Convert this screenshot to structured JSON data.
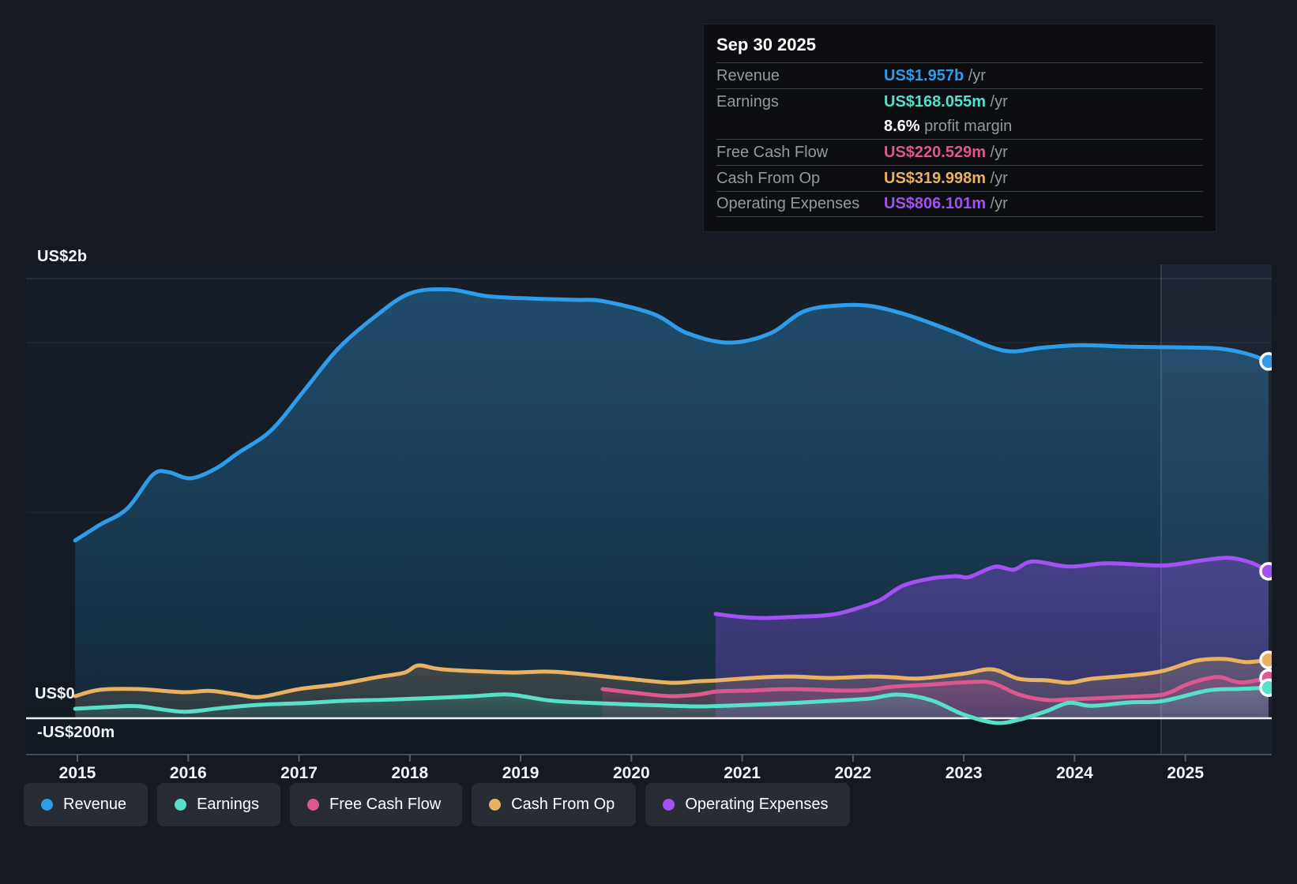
{
  "tooltip": {
    "title": "Sep 30 2025",
    "rows": [
      {
        "id": "revenue",
        "label": "Revenue",
        "value": "US$1.957b",
        "suffix": " /yr"
      },
      {
        "id": "earnings",
        "label": "Earnings",
        "value": "US$168.055m",
        "suffix": " /yr",
        "extra_value": "8.6%",
        "extra_text": " profit margin"
      },
      {
        "id": "fcf",
        "label": "Free Cash Flow",
        "value": "US$220.529m",
        "suffix": " /yr"
      },
      {
        "id": "cfo",
        "label": "Cash From Op",
        "value": "US$319.998m",
        "suffix": " /yr"
      },
      {
        "id": "opex",
        "label": "Operating Expenses",
        "value": "US$806.101m",
        "suffix": " /yr"
      }
    ]
  },
  "colors": {
    "revenue": "#2d9cea",
    "earnings": "#57e0c8",
    "fcf": "#de5890",
    "cfo": "#e8b260",
    "opex": "#a251f2",
    "zero_line": "#eef1f4",
    "axis_line": "#565d66",
    "gridline_faint": "rgba(255,255,255,0.07)",
    "gridline_top": "rgba(255,255,255,0.15)"
  },
  "y_axis": {
    "labels": [
      "US$2b",
      "US$0",
      "-US$200m"
    ]
  },
  "x_axis": {
    "years": [
      "2015",
      "2016",
      "2017",
      "2018",
      "2019",
      "2020",
      "2021",
      "2022",
      "2023",
      "2024",
      "2025"
    ]
  },
  "legend": [
    {
      "id": "revenue",
      "label": "Revenue"
    },
    {
      "id": "earnings",
      "label": "Earnings"
    },
    {
      "id": "fcf",
      "label": "Free Cash Flow"
    },
    {
      "id": "cfo",
      "label": "Cash From Op"
    },
    {
      "id": "opex",
      "label": "Operating Expenses"
    }
  ],
  "chart_data": {
    "type": "line",
    "title": "Financial history: revenue, earnings and cash flow",
    "x_unit": "year",
    "y_unit": "US$ millions",
    "x_range": [
      2014.97,
      2025.79
    ],
    "y_gridline_labels": [
      "US$2b",
      "US$0",
      "-US$200m"
    ],
    "highlight_band_start": 2024.78,
    "legend_position": "bottom",
    "grid": true,
    "series": [
      {
        "name": "Revenue",
        "id": "revenue",
        "final_label": "US$1.957b /yr",
        "points": [
          [
            2014.98,
            975
          ],
          [
            2015.2,
            1060
          ],
          [
            2015.45,
            1150
          ],
          [
            2015.68,
            1335
          ],
          [
            2015.82,
            1350
          ],
          [
            2016.02,
            1316
          ],
          [
            2016.25,
            1370
          ],
          [
            2016.45,
            1455
          ],
          [
            2016.75,
            1580
          ],
          [
            2017.05,
            1800
          ],
          [
            2017.35,
            2025
          ],
          [
            2017.68,
            2200
          ],
          [
            2018.0,
            2330
          ],
          [
            2018.35,
            2352
          ],
          [
            2018.7,
            2315
          ],
          [
            2019.1,
            2302
          ],
          [
            2019.5,
            2295
          ],
          [
            2019.75,
            2287
          ],
          [
            2020.2,
            2217
          ],
          [
            2020.5,
            2113
          ],
          [
            2020.88,
            2060
          ],
          [
            2021.25,
            2110
          ],
          [
            2021.55,
            2230
          ],
          [
            2021.85,
            2263
          ],
          [
            2022.15,
            2262
          ],
          [
            2022.5,
            2210
          ],
          [
            2022.9,
            2122
          ],
          [
            2023.25,
            2035
          ],
          [
            2023.45,
            2012
          ],
          [
            2023.7,
            2032
          ],
          [
            2024.05,
            2046
          ],
          [
            2024.5,
            2038
          ],
          [
            2024.95,
            2034
          ],
          [
            2025.3,
            2028
          ],
          [
            2025.55,
            2000
          ],
          [
            2025.75,
            1957
          ]
        ]
      },
      {
        "name": "Operating Expenses",
        "id": "opex",
        "final_label": "US$806.101m /yr",
        "points": [
          [
            2020.76,
            572
          ],
          [
            2021.0,
            555
          ],
          [
            2021.2,
            550
          ],
          [
            2021.5,
            557
          ],
          [
            2021.72,
            563
          ],
          [
            2021.88,
            576
          ],
          [
            2022.1,
            615
          ],
          [
            2022.25,
            650
          ],
          [
            2022.45,
            727
          ],
          [
            2022.7,
            766
          ],
          [
            2022.93,
            779
          ],
          [
            2023.05,
            775
          ],
          [
            2023.28,
            831
          ],
          [
            2023.45,
            815
          ],
          [
            2023.62,
            860
          ],
          [
            2023.95,
            832
          ],
          [
            2024.3,
            850
          ],
          [
            2024.8,
            838
          ],
          [
            2025.15,
            866
          ],
          [
            2025.4,
            880
          ],
          [
            2025.6,
            852
          ],
          [
            2025.75,
            806
          ]
        ]
      },
      {
        "name": "Cash From Op",
        "id": "cfo",
        "final_label": "US$319.998m /yr",
        "points": [
          [
            2014.98,
            121
          ],
          [
            2015.2,
            156
          ],
          [
            2015.55,
            160
          ],
          [
            2015.95,
            143
          ],
          [
            2016.2,
            150
          ],
          [
            2016.45,
            130
          ],
          [
            2016.65,
            117
          ],
          [
            2017.0,
            160
          ],
          [
            2017.35,
            186
          ],
          [
            2017.7,
            225
          ],
          [
            2017.95,
            250
          ],
          [
            2018.08,
            290
          ],
          [
            2018.3,
            268
          ],
          [
            2018.9,
            251
          ],
          [
            2019.3,
            255
          ],
          [
            2019.9,
            221
          ],
          [
            2020.35,
            195
          ],
          [
            2020.6,
            203
          ],
          [
            2020.78,
            208
          ],
          [
            2021.2,
            225
          ],
          [
            2021.45,
            229
          ],
          [
            2021.8,
            221
          ],
          [
            2022.15,
            229
          ],
          [
            2022.36,
            225
          ],
          [
            2022.6,
            218
          ],
          [
            2023.0,
            245
          ],
          [
            2023.26,
            268
          ],
          [
            2023.5,
            216
          ],
          [
            2023.75,
            208
          ],
          [
            2023.95,
            195
          ],
          [
            2024.15,
            216
          ],
          [
            2024.55,
            238
          ],
          [
            2024.8,
            260
          ],
          [
            2025.1,
            316
          ],
          [
            2025.35,
            325
          ],
          [
            2025.55,
            308
          ],
          [
            2025.75,
            320
          ]
        ]
      },
      {
        "name": "Free Cash Flow",
        "id": "fcf",
        "final_label": "US$220.529m /yr",
        "points": [
          [
            2019.74,
            160
          ],
          [
            2020.1,
            135
          ],
          [
            2020.36,
            121
          ],
          [
            2020.6,
            130
          ],
          [
            2020.78,
            147
          ],
          [
            2021.07,
            152
          ],
          [
            2021.45,
            160
          ],
          [
            2021.9,
            152
          ],
          [
            2022.15,
            156
          ],
          [
            2022.36,
            173
          ],
          [
            2022.7,
            185
          ],
          [
            2023.07,
            199
          ],
          [
            2023.26,
            193
          ],
          [
            2023.5,
            130
          ],
          [
            2023.75,
            100
          ],
          [
            2023.95,
            104
          ],
          [
            2024.15,
            108
          ],
          [
            2024.5,
            118
          ],
          [
            2024.8,
            130
          ],
          [
            2025.0,
            182
          ],
          [
            2025.18,
            216
          ],
          [
            2025.32,
            225
          ],
          [
            2025.5,
            196
          ],
          [
            2025.75,
            220.5
          ]
        ]
      },
      {
        "name": "Earnings",
        "id": "earnings",
        "final_label": "US$168.055m /yr",
        "points": [
          [
            2014.98,
            52
          ],
          [
            2015.3,
            62
          ],
          [
            2015.55,
            66
          ],
          [
            2015.95,
            36
          ],
          [
            2016.3,
            56
          ],
          [
            2016.65,
            74
          ],
          [
            2017.0,
            82
          ],
          [
            2017.4,
            95
          ],
          [
            2017.8,
            102
          ],
          [
            2018.15,
            110
          ],
          [
            2018.55,
            120
          ],
          [
            2018.9,
            130
          ],
          [
            2019.3,
            95
          ],
          [
            2019.9,
            78
          ],
          [
            2020.3,
            70
          ],
          [
            2020.62,
            65
          ],
          [
            2021.0,
            72
          ],
          [
            2021.4,
            82
          ],
          [
            2021.8,
            95
          ],
          [
            2022.15,
            108
          ],
          [
            2022.4,
            130
          ],
          [
            2022.7,
            100
          ],
          [
            2023.0,
            20
          ],
          [
            2023.28,
            -25
          ],
          [
            2023.5,
            -8
          ],
          [
            2023.75,
            40
          ],
          [
            2023.95,
            85
          ],
          [
            2024.15,
            68
          ],
          [
            2024.5,
            87
          ],
          [
            2024.8,
            95
          ],
          [
            2025.2,
            152
          ],
          [
            2025.5,
            161
          ],
          [
            2025.75,
            168
          ]
        ]
      }
    ]
  }
}
